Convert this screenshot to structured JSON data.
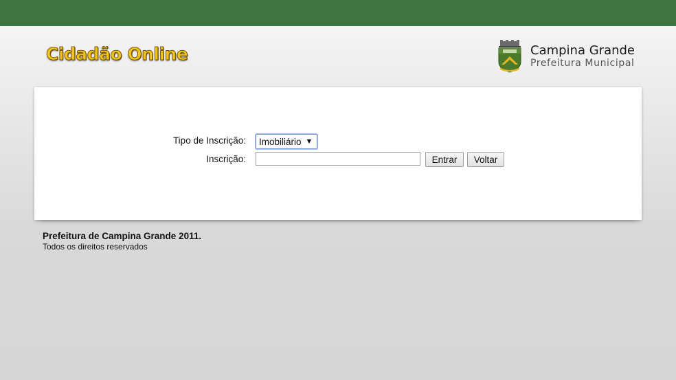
{
  "colors": {
    "topbar": "#3f7440",
    "title_gold": "#f0c419",
    "crest_green": "#4a7a2a",
    "crest_gold": "#e2b321"
  },
  "header": {
    "site_title": "Cidadão Online",
    "brand_name": "Campina Grande",
    "brand_subtitle": "Prefeitura Municipal",
    "crest_icon": "city-crest-icon"
  },
  "form": {
    "tipo_label": "Tipo de Inscrição:",
    "tipo_selected": "Imobiliário",
    "inscricao_label": "Inscrição:",
    "inscricao_value": "",
    "entrar_label": "Entrar",
    "voltar_label": "Voltar"
  },
  "footer": {
    "title": "Prefeitura de Campina Grande 2011.",
    "subtitle": "Todos os direitos reservados"
  }
}
